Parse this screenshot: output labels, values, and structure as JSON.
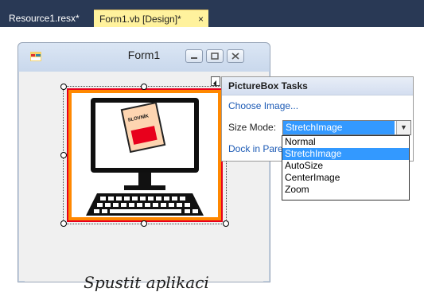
{
  "tabs": {
    "resource_tab": "Resource1.resx*",
    "form_tab": "Form1.vb [Design]*",
    "close_glyph": "×"
  },
  "form": {
    "title": "Form1",
    "launch_text": "Spustit aplikaci",
    "book_label": "SLOVNÍK",
    "colors": {
      "picture_frame_outer": "#e8001c",
      "picture_frame_inner": "#ff8800"
    }
  },
  "tasks": {
    "header": "PictureBox Tasks",
    "choose_image": "Choose Image...",
    "size_mode_label": "Size Mode:",
    "size_mode_value": "StretchImage",
    "dock": "Dock in Parent Container",
    "options": [
      "Normal",
      "StretchImage",
      "AutoSize",
      "CenterImage",
      "Zoom"
    ],
    "selected_option": "StretchImage"
  },
  "colors": {
    "selection_blue": "#3399ff",
    "tabbar_bg": "#293955",
    "active_tab_bg": "#fff29d",
    "link_blue": "#1c5ab5"
  }
}
